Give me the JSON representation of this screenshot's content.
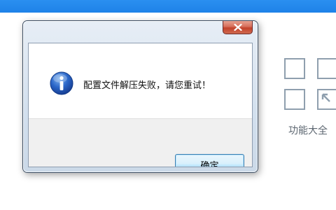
{
  "background_app": {
    "feature_label": "功能大全",
    "grid_icon": "feature-grid-icon"
  },
  "dialog": {
    "close_icon": "close-icon",
    "icon": "info-icon",
    "message": "配置文件解压失败，请您重试！",
    "ok_label": "确定"
  },
  "colors": {
    "top_band": "#1e82e8",
    "info_icon": "#1f5bbd",
    "close_button": "#c2412a",
    "ok_button_border": "#3c7fb1"
  }
}
